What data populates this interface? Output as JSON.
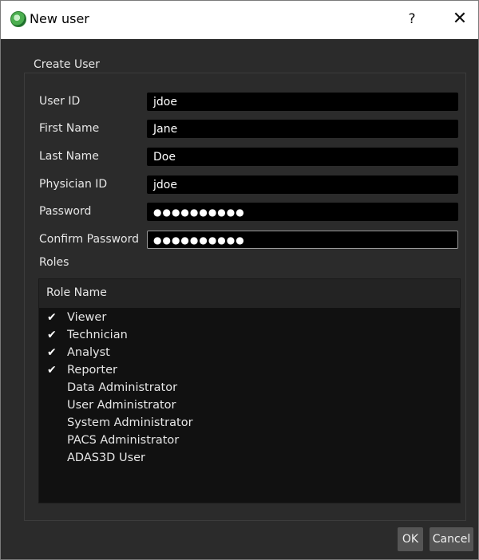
{
  "window": {
    "title": "New user",
    "help": "?",
    "close": "✕"
  },
  "group_title": "Create User",
  "fields": [
    {
      "label": "User ID",
      "value": "jdoe"
    },
    {
      "label": "First Name",
      "value": "Jane"
    },
    {
      "label": "Last Name",
      "value": "Doe"
    },
    {
      "label": "Physician ID",
      "value": "jdoe"
    },
    {
      "label": "Password",
      "value": "●●●●●●●●●●"
    },
    {
      "label": "Confirm Password",
      "value": "●●●●●●●●●●"
    }
  ],
  "roles": {
    "label": "Roles",
    "header": "Role Name",
    "check_glyph": "✔",
    "items": [
      {
        "name": "Viewer",
        "checked": true
      },
      {
        "name": "Technician",
        "checked": true
      },
      {
        "name": "Analyst",
        "checked": true
      },
      {
        "name": "Reporter",
        "checked": true
      },
      {
        "name": "Data Administrator",
        "checked": false
      },
      {
        "name": "User Administrator",
        "checked": false
      },
      {
        "name": "System Administrator",
        "checked": false
      },
      {
        "name": "PACS Administrator",
        "checked": false
      },
      {
        "name": "ADAS3D User",
        "checked": false
      }
    ]
  },
  "buttons": {
    "ok": "OK",
    "cancel": "Cancel"
  }
}
